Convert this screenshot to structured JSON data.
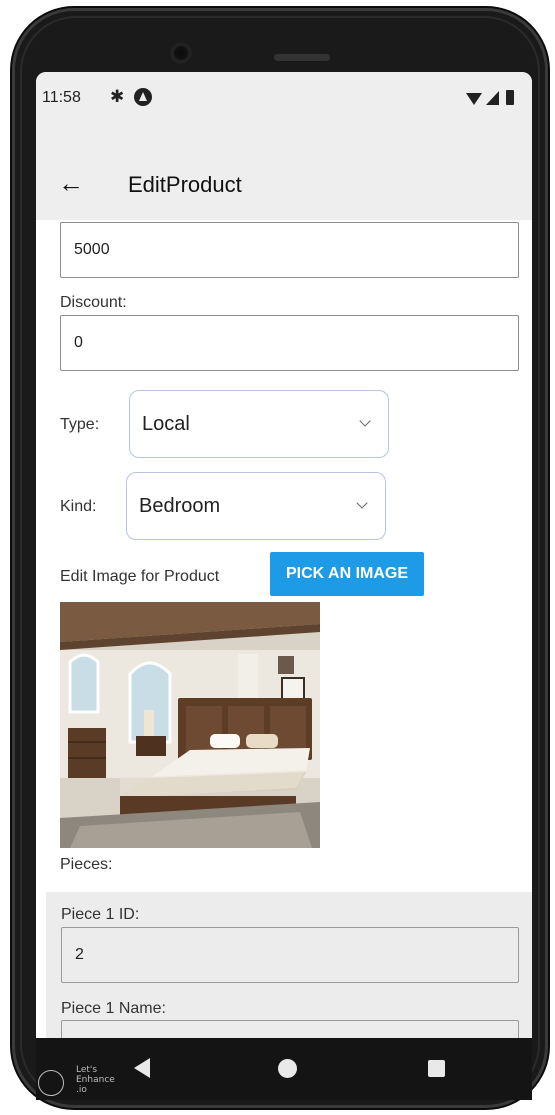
{
  "status_bar": {
    "time": "11:58",
    "settings_icon": "gear-icon",
    "app_icon": "notification-app-icon"
  },
  "app_bar": {
    "back_icon": "arrow-left-icon",
    "back_glyph": "←",
    "title": "EditProduct"
  },
  "form": {
    "price_value": "5000",
    "discount_label": "Discount:",
    "discount_value": "0",
    "type_label": "Type:",
    "type_value": "Local",
    "kind_label": "Kind:",
    "kind_value": "Bedroom",
    "edit_image_label": "Edit Image for Product",
    "pick_image_button": "PICK AN IMAGE",
    "pieces_label": "Pieces:",
    "pieces": [
      {
        "id_label": "Piece 1 ID:",
        "id_value": "2",
        "name_label": "Piece 1 Name:"
      }
    ]
  },
  "watermark": {
    "line1": "Let's",
    "line2": "Enhance",
    "line3": ".io"
  },
  "colors": {
    "accent": "#1e9be7",
    "app_bar": "#eeeeee",
    "nav_bar": "#141414"
  }
}
